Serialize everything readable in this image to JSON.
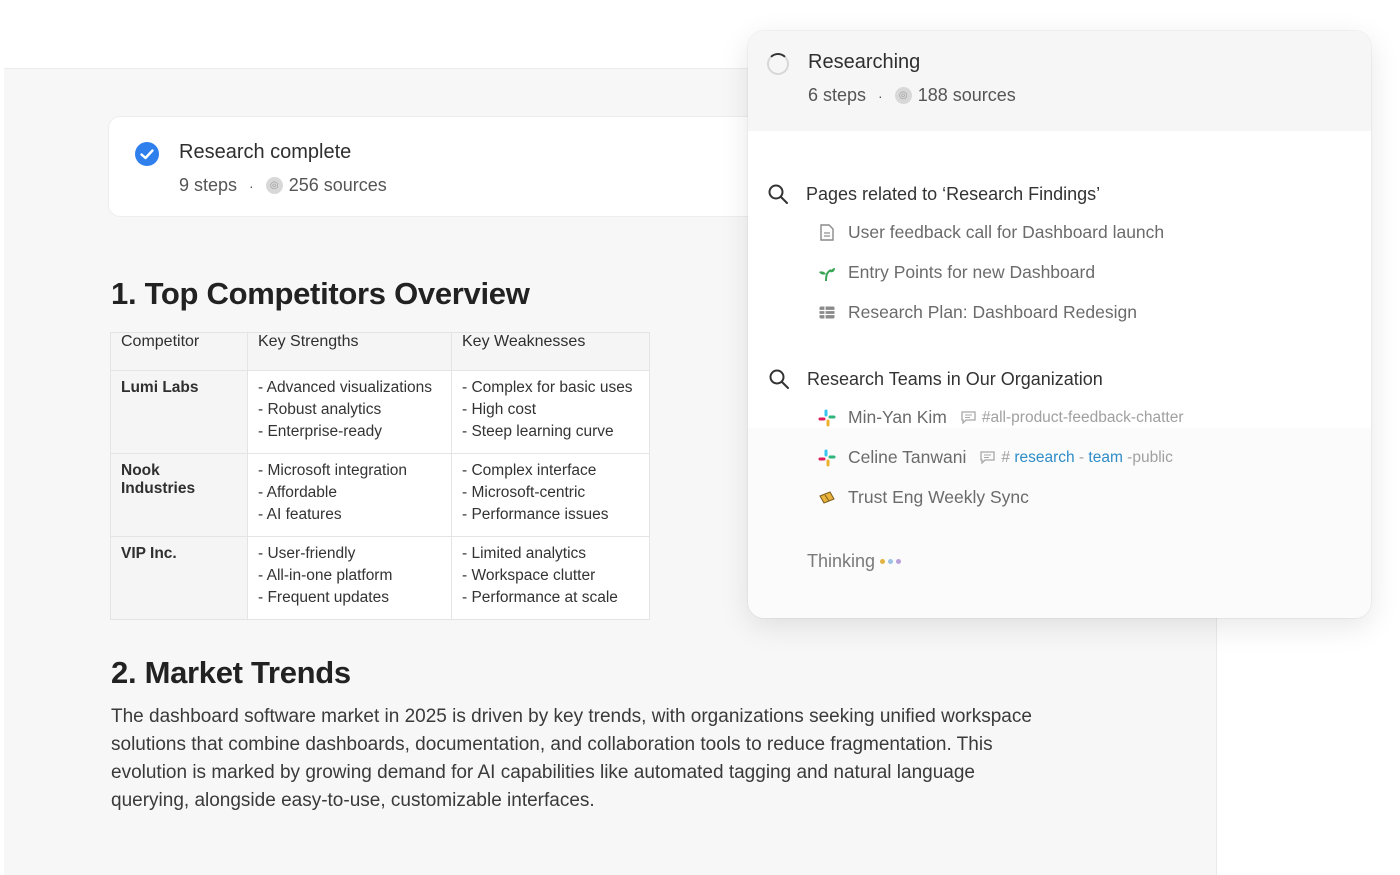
{
  "research_complete": {
    "title": "Research complete",
    "steps": "9 steps",
    "separator": "·",
    "sources": "256 sources"
  },
  "competitors": {
    "heading": "1. Top Competitors Overview",
    "columns": [
      "Competitor",
      "Key Strengths",
      "Key Weaknesses"
    ],
    "rows": [
      {
        "name": "Lumi Labs",
        "strengths": [
          "- Advanced visualizations",
          "- Robust analytics",
          "- Enterprise-ready"
        ],
        "weaknesses": [
          "- Complex for basic uses",
          "- High cost",
          "- Steep learning curve"
        ]
      },
      {
        "name": "Nook Industries",
        "strengths": [
          "- Microsoft integration",
          "- Affordable",
          "- AI features"
        ],
        "weaknesses": [
          "- Complex interface",
          "- Microsoft-centric",
          "- Performance issues"
        ]
      },
      {
        "name": "VIP Inc.",
        "strengths": [
          "- User-friendly",
          "- All-in-one platform",
          "- Frequent updates"
        ],
        "weaknesses": [
          "- Limited analytics",
          "- Workspace clutter",
          "- Performance at scale"
        ]
      }
    ]
  },
  "trends": {
    "heading": "2. Market Trends",
    "body": "The dashboard software market in 2025 is driven by key trends, with organizations seeking unified workspace solutions that combine dashboards, documentation, and collaboration tools to reduce fragmentation. This evolution is marked by growing demand for AI capabilities like automated tagging and natural language querying, alongside easy-to-use, customizable interfaces."
  },
  "researching": {
    "title": "Researching",
    "steps": "6 steps",
    "separator": "·",
    "sources": "188 sources",
    "groups": [
      {
        "label": "Pages related to ‘Research Findings’",
        "items": [
          {
            "label": "User feedback call for Dashboard launch",
            "icon": "page-icon"
          },
          {
            "label": "Entry Points for new Dashboard",
            "icon": "sprout-icon"
          },
          {
            "label": "Research Plan: Dashboard Redesign",
            "icon": "table-icon"
          }
        ]
      },
      {
        "label": "Research Teams in Our Organization",
        "items": [
          {
            "label": "Min-Yan Kim",
            "icon": "slack-icon",
            "channel": "#all-product-feedback-chatter"
          },
          {
            "label": "Celine Tanwani",
            "icon": "slack-icon",
            "channel_prefix": "#",
            "channel_hl1": "research",
            "channel_sep1": " - ",
            "channel_hl2": "team",
            "channel_suffix": " -public"
          },
          {
            "label": "Trust Eng Weekly Sync",
            "icon": "ticket-icon"
          }
        ]
      }
    ],
    "thinking": "Thinking"
  },
  "colors": {
    "accent_blue": "#2f80ed",
    "link_blue": "#2e8cc7",
    "thinking_dots": [
      "#e3b341",
      "#9cc3e6",
      "#b9a0d8"
    ]
  }
}
